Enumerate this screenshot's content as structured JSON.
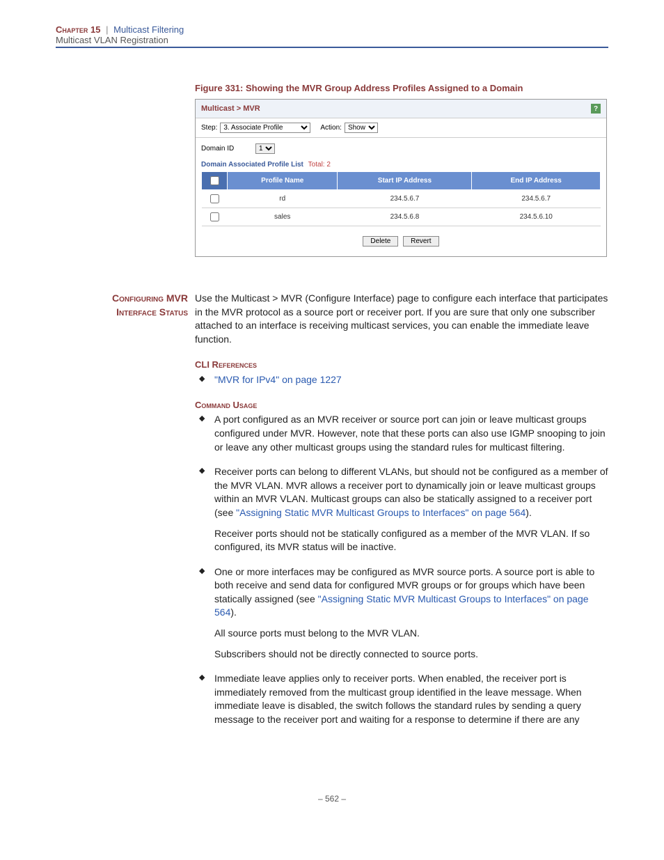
{
  "header": {
    "chapter": "Chapter 15",
    "section": "Multicast Filtering",
    "subsection": "Multicast VLAN Registration"
  },
  "figure": {
    "caption": "Figure 331:  Showing the MVR Group Address Profiles Assigned to a Domain"
  },
  "screenshot": {
    "breadcrumb": "Multicast > MVR",
    "step_label": "Step:",
    "step_value": "3. Associate Profile",
    "action_label": "Action:",
    "action_value": "Show",
    "domain_id_label": "Domain ID",
    "domain_id_value": "1",
    "list_label": "Domain Associated Profile List",
    "list_total_label": "Total: 2",
    "columns": [
      "Profile Name",
      "Start IP Address",
      "End IP Address"
    ],
    "rows": [
      {
        "name": "rd",
        "start": "234.5.6.7",
        "end": "234.5.6.7"
      },
      {
        "name": "sales",
        "start": "234.5.6.8",
        "end": "234.5.6.10"
      }
    ],
    "delete_btn": "Delete",
    "revert_btn": "Revert"
  },
  "section": {
    "title_line1": "Configuring MVR",
    "title_line2": "Interface Status",
    "intro": "Use the Multicast > MVR (Configure Interface) page to configure each interface that participates in the MVR protocol as a source port or receiver port. If you are sure that only one subscriber attached to an interface is receiving multicast services, you can enable the immediate leave function.",
    "cli_heading": "CLI References",
    "cli_link": "\"MVR for IPv4\" on page 1227",
    "usage_heading": "Command Usage",
    "bullets": {
      "b1": "A port configured as an MVR receiver or source port can join or leave multicast groups configured under MVR. However, note that these ports can also use IGMP snooping to join or leave any other multicast groups using the standard rules for multicast filtering.",
      "b2_p1_a": "Receiver ports can belong to different VLANs, but should not be configured as a member of the MVR VLAN. MVR allows a receiver port to dynamically join or leave multicast groups within an MVR VLAN. Multicast groups can also be statically assigned to a receiver port (see ",
      "b2_link": "\"Assigning Static MVR Multicast Groups to Interfaces\" on page 564",
      "b2_p1_b": ").",
      "b2_p2": "Receiver ports should not be statically configured as a member of the MVR VLAN. If so configured, its MVR status will be inactive.",
      "b3_p1_a": "One or more interfaces may be configured as MVR source ports. A source port is able to both receive and send data for configured MVR groups or for groups which have been statically assigned (see ",
      "b3_link": "\"Assigning Static MVR Multicast Groups to Interfaces\" on page 564",
      "b3_p1_b": ").",
      "b3_p2": "All source ports must belong to the MVR VLAN.",
      "b3_p3": "Subscribers should not be directly connected to source ports.",
      "b4": "Immediate leave applies only to receiver ports. When enabled, the receiver port is immediately removed from the multicast group identified in the leave message. When immediate leave is disabled, the switch follows the standard rules by sending a query message to the receiver port and waiting for a response to determine if there are any"
    }
  },
  "page_number": "–  562  –"
}
